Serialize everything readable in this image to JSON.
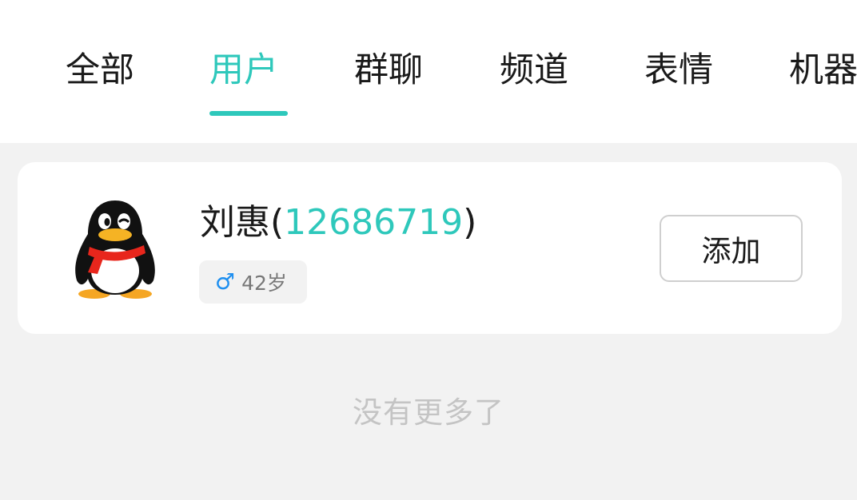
{
  "tabs": [
    {
      "label": "全部"
    },
    {
      "label": "用户"
    },
    {
      "label": "群聊"
    },
    {
      "label": "频道"
    },
    {
      "label": "表情"
    },
    {
      "label": "机器"
    }
  ],
  "active_tab": "用户",
  "colors": {
    "accent": "#2ec8bb",
    "gender_male": "#1e8ff0",
    "muted_text": "#c4c4c4"
  },
  "result": {
    "name": "刘惠",
    "paren_open": "(",
    "qq_number": "12686719",
    "paren_close": ")",
    "gender_symbol": "♂",
    "age": "42岁",
    "add_label": "添加",
    "avatar_icon": "qq-penguin-icon"
  },
  "footer": {
    "no_more": "没有更多了"
  }
}
